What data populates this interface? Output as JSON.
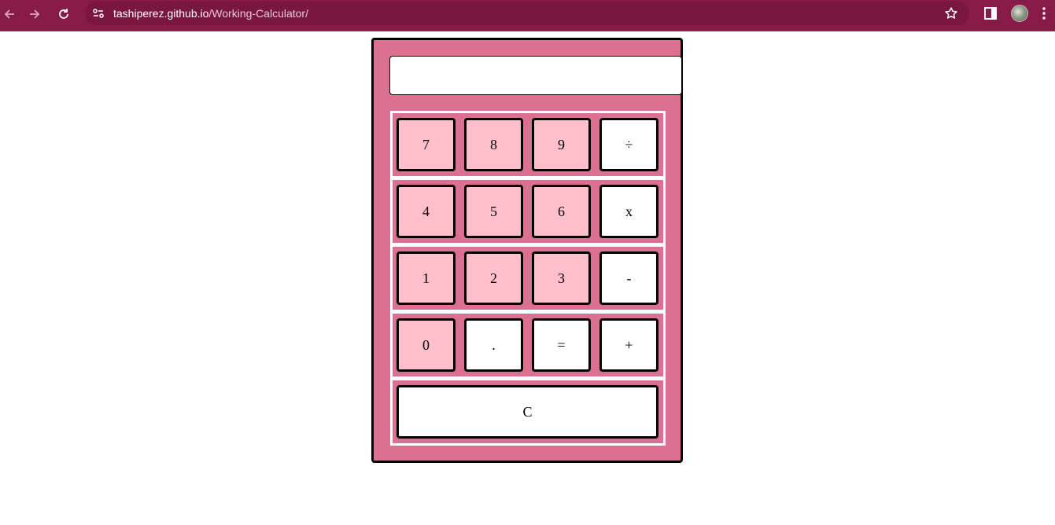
{
  "browser": {
    "url_host": "tashiperez.github.io",
    "url_path": "/Working-Calculator/"
  },
  "calculator": {
    "display_value": "",
    "rows": [
      [
        "7",
        "8",
        "9",
        "÷"
      ],
      [
        "4",
        "5",
        "6",
        "x"
      ],
      [
        "1",
        "2",
        "3",
        "-"
      ],
      [
        "0",
        ".",
        "=",
        "+"
      ]
    ],
    "clear_label": "C"
  },
  "colors": {
    "chrome": "#871b47",
    "body": "#db7093",
    "number_key": "#ffc0cb",
    "operator_key": "#ffffff"
  }
}
